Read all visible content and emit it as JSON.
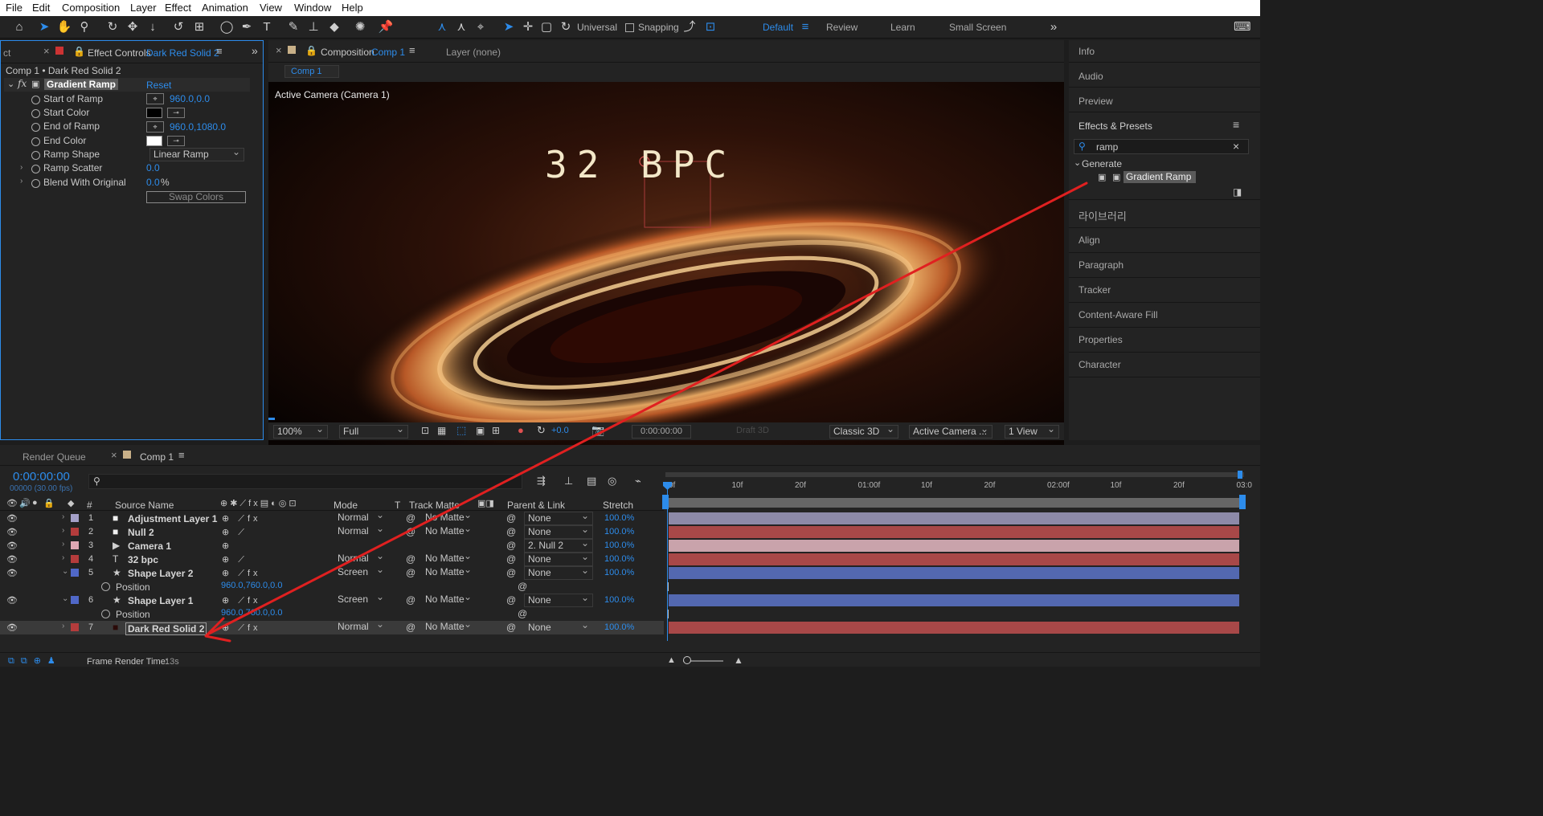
{
  "menu": [
    "File",
    "Edit",
    "Composition",
    "Layer",
    "Effect",
    "Animation",
    "View",
    "Window",
    "Help"
  ],
  "toolbar": {
    "universal_label": "Universal",
    "snapping_label": "Snapping",
    "workspaces": [
      "Default",
      "Review",
      "Learn",
      "Small Screen"
    ],
    "active_workspace": "Default"
  },
  "effect_controls": {
    "tab_cut": "ct",
    "tab_label": "Effect Controls",
    "tab_target": "Dark Red Solid 2",
    "breadcrumb": "Comp 1 • Dark Red Solid 2",
    "effect_name": "Gradient Ramp",
    "reset_label": "Reset",
    "props": {
      "start_of_ramp": {
        "label": "Start of Ramp",
        "value": "960.0,0.0"
      },
      "start_color": {
        "label": "Start Color",
        "color": "#000000"
      },
      "end_of_ramp": {
        "label": "End of Ramp",
        "value": "960.0,1080.0"
      },
      "end_color": {
        "label": "End Color",
        "color": "#ffffff"
      },
      "ramp_shape": {
        "label": "Ramp Shape",
        "value": "Linear Ramp"
      },
      "ramp_scatter": {
        "label": "Ramp Scatter",
        "value": "0.0"
      },
      "blend": {
        "label": "Blend With Original",
        "value": "0.0",
        "unit": "%"
      }
    },
    "swap_colors_label": "Swap Colors"
  },
  "composition": {
    "tab_label": "Composition",
    "tab_target": "Comp 1",
    "layer_tab": "Layer (none)",
    "sub_tab": "Comp 1",
    "camera_label": "Active Camera (Camera 1)",
    "title_text": "32 BPC",
    "zoom": "100%",
    "resolution": "Full",
    "exposure": "+0.0",
    "timecode": "0:00:00:00",
    "draft3d_label": "Draft 3D",
    "renderer": "Classic 3D",
    "camera_select": "Active Camera ...",
    "view_select": "1 View"
  },
  "right_panel": {
    "items_top": [
      "Info",
      "Audio",
      "Preview"
    ],
    "effects_title": "Effects & Presets",
    "search_value": "ramp",
    "category": "Generate",
    "result": "Gradient Ramp",
    "items_bottom": [
      "라이브러리",
      "Align",
      "Paragraph",
      "Tracker",
      "Content-Aware Fill",
      "Properties",
      "Character"
    ]
  },
  "timeline": {
    "render_queue": "Render Queue",
    "comp_tab": "Comp 1",
    "timecode": "0:00:00:00",
    "fps": "00000 (30.00 fps)",
    "headers": {
      "num": "#",
      "source": "Source Name",
      "mode": "Mode",
      "t": "T",
      "track_matte": "Track Matte",
      "parent": "Parent & Link",
      "stretch": "Stretch"
    },
    "layers": [
      {
        "num": "1",
        "name": "Adjustment Layer 1",
        "color": "#a4a0c8",
        "icon": "white-square-icon",
        "mode": "Normal",
        "matte": "No Matte",
        "parent": "None",
        "stretch": "100.0%"
      },
      {
        "num": "2",
        "name": "Null 2",
        "color": "#b43c3c",
        "icon": "white-square-icon",
        "mode": "Normal",
        "matte": "No Matte",
        "parent": "None",
        "stretch": "100.0%"
      },
      {
        "num": "3",
        "name": "Camera 1",
        "color": "#e0a8b4",
        "icon": "camera-icon",
        "mode": "",
        "matte": "",
        "parent": "2. Null 2",
        "stretch": "100.0%"
      },
      {
        "num": "4",
        "name": "32 bpc",
        "color": "#b43c3c",
        "icon": "text-icon",
        "mode": "Normal",
        "matte": "No Matte",
        "parent": "None",
        "stretch": "100.0%"
      },
      {
        "num": "5",
        "name": "Shape Layer 2",
        "color": "#5068c8",
        "icon": "star-icon",
        "mode": "Screen",
        "matte": "No Matte",
        "parent": "None",
        "stretch": "100.0%"
      },
      {
        "num": "6",
        "name": "Shape Layer 1",
        "color": "#5068c8",
        "icon": "star-icon",
        "mode": "Screen",
        "matte": "No Matte",
        "parent": "None",
        "stretch": "100.0%"
      },
      {
        "num": "7",
        "name": "Dark Red Solid 2",
        "color": "#b43c3c",
        "icon": "dark-square-icon",
        "mode": "Normal",
        "matte": "No Matte",
        "parent": "None",
        "stretch": "100.0%"
      }
    ],
    "position_label": "Position",
    "position_value": "960.0,760.0,0.0",
    "ruler": [
      "0f",
      "10f",
      "20f",
      "01:00f",
      "10f",
      "20f",
      "02:00f",
      "10f",
      "20f",
      "03:0"
    ],
    "frame_render_label": "Frame Render Time:",
    "frame_render_value": "13s"
  }
}
